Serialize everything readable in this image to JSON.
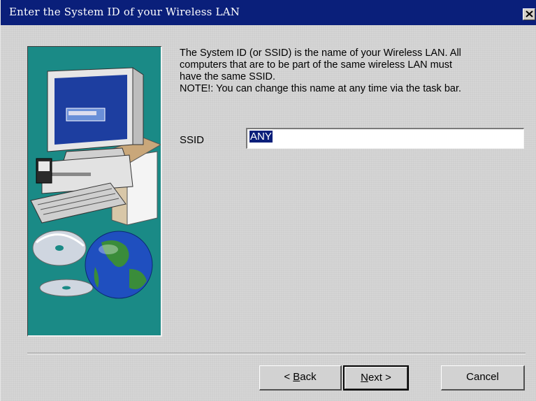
{
  "window": {
    "title": "Enter the System ID of your Wireless LAN"
  },
  "description": {
    "line1": "The System ID (or SSID) is the name of your Wireless LAN.  All",
    "line2": "computers that are to be part of the same wireless LAN must",
    "line3": "have the same SSID.",
    "line4": "NOTE!: You can change this name at any time via the task bar."
  },
  "ssid": {
    "label": "SSID",
    "value": "ANY"
  },
  "buttons": {
    "back_prefix": "< ",
    "back_mnemonic": "B",
    "back_rest": "ack",
    "next_mnemonic": "N",
    "next_rest": "ext >",
    "cancel": "Cancel"
  },
  "colors": {
    "titlebar": "#0a1f7a",
    "side_panel": "#1a8a86",
    "dialog_bg": "#cfcfcf"
  },
  "icons": [
    "close-icon",
    "computer-illustration",
    "globe-illustration",
    "cd-disc-illustration"
  ]
}
